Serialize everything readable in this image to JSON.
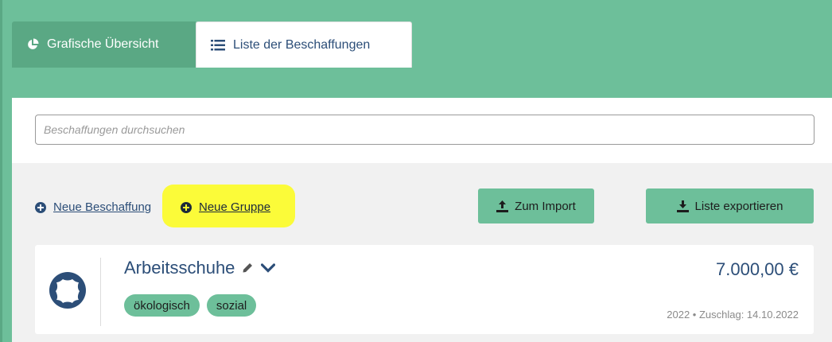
{
  "tabs": [
    {
      "label": "Grafische Übersicht",
      "icon": "pie-chart-icon",
      "active": false
    },
    {
      "label": "Liste der Beschaffungen",
      "icon": "list-icon",
      "active": true
    }
  ],
  "search": {
    "placeholder": "Beschaffungen durchsuchen",
    "value": ""
  },
  "actions": {
    "new_procurement": "Neue Beschaffung",
    "new_group": "Neue Gruppe",
    "import_button": "Zum Import",
    "export_button": "Liste exportieren"
  },
  "card": {
    "title": "Arbeitsschuhe",
    "tags": [
      "ökologisch",
      "sozial"
    ],
    "price": "7.000,00 €",
    "meta": "2022 • Zuschlag: 14.10.2022",
    "icon": "leather-icon"
  },
  "colors": {
    "background": "#6dbf9a",
    "accent_dark": "#5aa884",
    "text_blue": "#2c4e78",
    "highlight": "#fbfb2e"
  }
}
